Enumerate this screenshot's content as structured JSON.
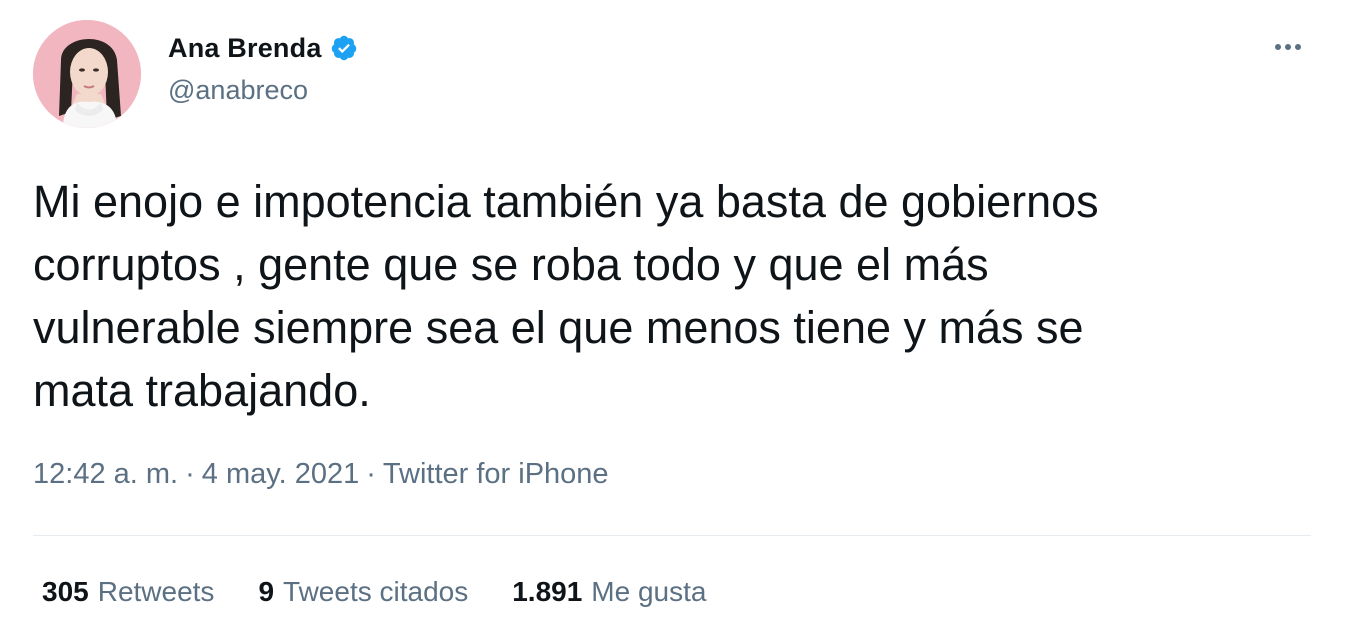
{
  "author": {
    "display_name": "Ana Brenda",
    "handle": "@anabreco",
    "verified": true,
    "verified_color": "#1da1f2",
    "avatar_icon": "profile-photo"
  },
  "menu": {
    "icon": "more-horizontal-icon"
  },
  "tweet": {
    "text": "Mi enojo e impotencia también ya basta de gobiernos\ncorruptos , gente que se roba todo y que el más\nvulnerable siempre sea el que menos tiene y más se\nmata trabajando."
  },
  "meta": {
    "time": "12:42 a. m.",
    "separator": "·",
    "date": "4 may. 2021",
    "source": "Twitter for iPhone"
  },
  "stats": {
    "retweets": {
      "count": "305",
      "label": "Retweets"
    },
    "quotes": {
      "count": "9",
      "label": "Tweets citados"
    },
    "likes": {
      "count": "1.891",
      "label": "Me gusta"
    }
  },
  "colors": {
    "text": "#0f1419",
    "secondary": "#5b7083",
    "divider": "#e6ecf0",
    "avatar_bg": "#f2b6c1"
  }
}
